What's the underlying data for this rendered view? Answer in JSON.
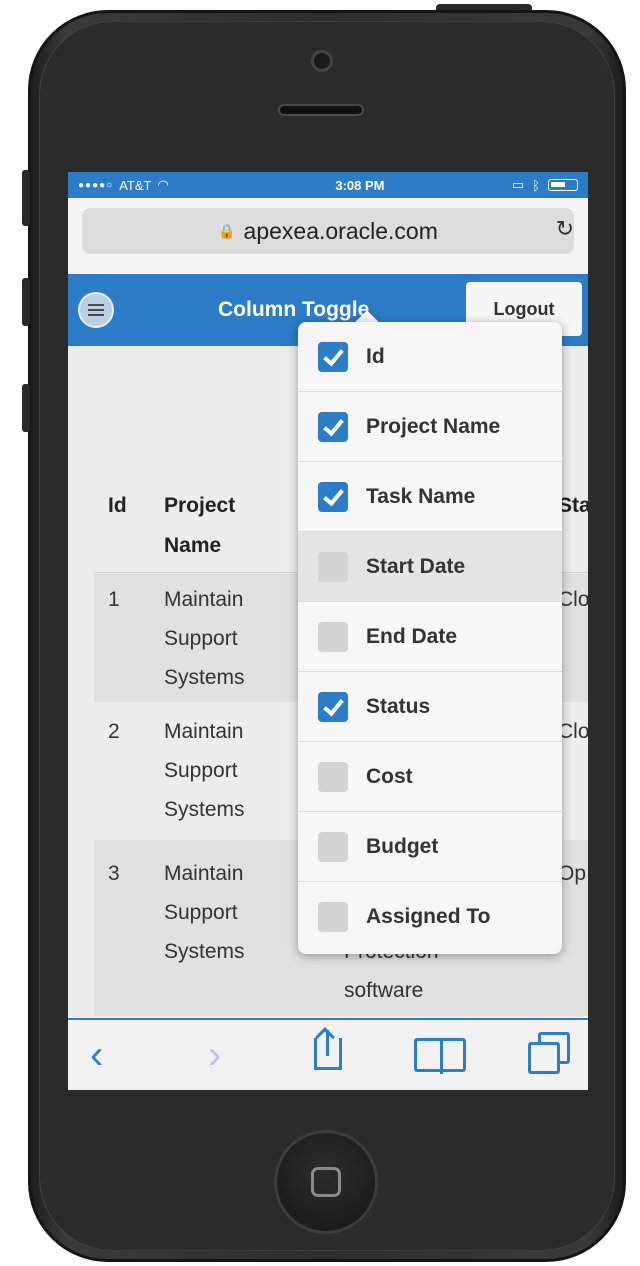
{
  "statusbar": {
    "carrier": "AT&T",
    "time": "3:08 PM"
  },
  "browser": {
    "url": "apexea.oracle.com"
  },
  "header": {
    "title": "Column Toggle",
    "logout_label": "Logout"
  },
  "table": {
    "columns": [
      "Id",
      "Project",
      "Name",
      "Sta"
    ],
    "rows": [
      {
        "id": "1",
        "project": [
          "Maintain",
          "Support",
          "Systems"
        ],
        "status": "Clo"
      },
      {
        "id": "2",
        "project": [
          "Maintain",
          "Support",
          "Systems"
        ],
        "status": "Clo"
      },
      {
        "id": "3",
        "project": [
          "Maintain",
          "Support",
          "Systems"
        ],
        "task_fragment": [
          "Protection",
          "software"
        ],
        "status": "Op"
      }
    ]
  },
  "column_toggle": {
    "options": [
      {
        "label": "Id",
        "checked": true
      },
      {
        "label": "Project Name",
        "checked": true
      },
      {
        "label": "Task Name",
        "checked": true
      },
      {
        "label": "Start Date",
        "checked": false
      },
      {
        "label": "End Date",
        "checked": false
      },
      {
        "label": "Status",
        "checked": true
      },
      {
        "label": "Cost",
        "checked": false
      },
      {
        "label": "Budget",
        "checked": false
      },
      {
        "label": "Assigned To",
        "checked": false
      }
    ]
  },
  "toolbar": {
    "back_icon": "‹",
    "forward_icon": "›"
  },
  "colors": {
    "accent": "#2d7cc7"
  }
}
